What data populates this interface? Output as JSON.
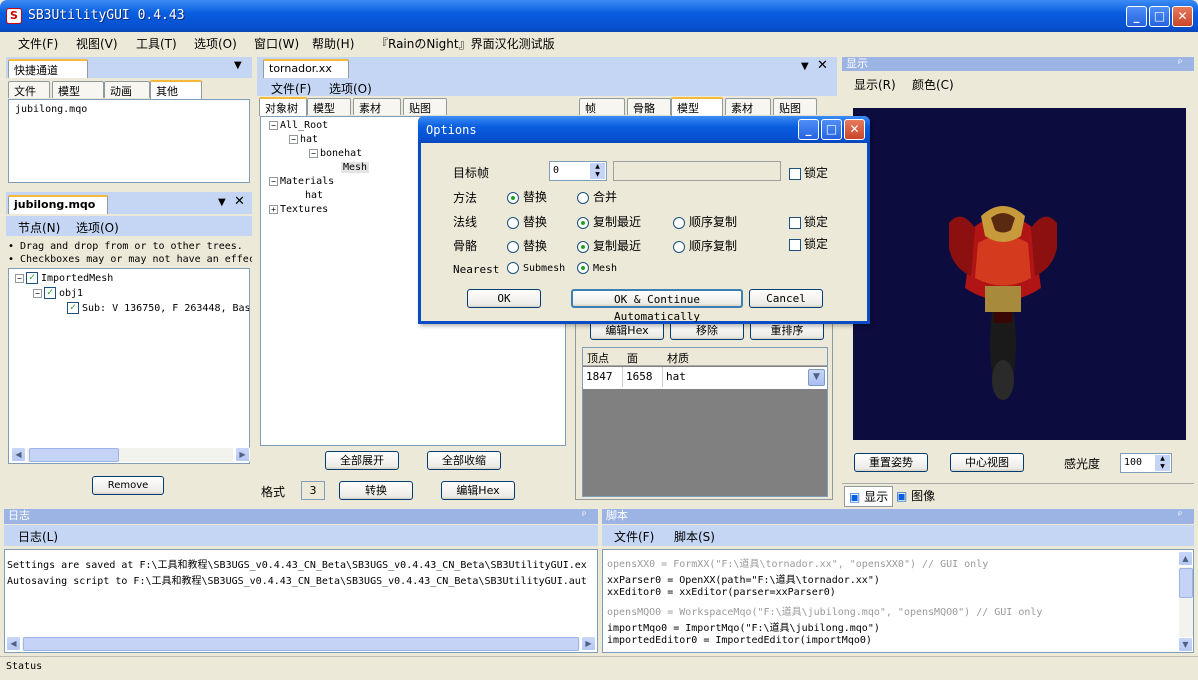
{
  "window": {
    "title": "SB3UtilityGUI 0.4.43"
  },
  "menubar": {
    "items": [
      "文件(F)",
      "视图(V)",
      "工具(T)",
      "选项(O)",
      "窗口(W)",
      "帮助(H)",
      "『RainのNight』界面汉化测试版"
    ]
  },
  "quick_access": {
    "tab": "快捷通道",
    "subtabs": [
      "文件",
      "模型",
      "动画",
      "其他"
    ],
    "active_subtab": "其他",
    "files": [
      "jubilong.mqo"
    ]
  },
  "mqo_panel": {
    "tab": "jubilong.mqo",
    "menu": [
      "节点(N)",
      "选项(O)"
    ],
    "hints": [
      "• Drag and drop from or to other trees.",
      "• Checkboxes may or may not have an effec"
    ],
    "tree": [
      "ImportedMesh",
      "obj1",
      "Sub: V 136750, F 263448, Bas"
    ],
    "remove_button": "Remove"
  },
  "xx_panel": {
    "tab": "tornador.xx",
    "menu": [
      "文件(F)",
      "选项(O)"
    ],
    "subtabs_left": [
      "对象树",
      "模型",
      "素材",
      "贴图"
    ],
    "active_left": "对象树",
    "tree": [
      "All_Root",
      "hat",
      "bonehat",
      "Mesh",
      "Materials",
      "hat",
      "Textures"
    ],
    "expand_all": "全部展开",
    "collapse_all": "全部收缩",
    "format_label": "格式",
    "format_value": "3",
    "convert_button": "转换",
    "edit_hex_button": "编辑Hex",
    "subtabs_right": [
      "帧",
      "骨骼",
      "模型",
      "素材",
      "贴图"
    ],
    "active_right": "模型",
    "mesh_edit_hex": "编辑Hex",
    "mesh_remove": "移除",
    "mesh_reorder": "重排序",
    "grid_headers": [
      "顶点",
      "面",
      "材质"
    ],
    "grid_row": {
      "vertices": "1847",
      "faces": "1658",
      "material": "hat"
    }
  },
  "options_dialog": {
    "title": "Options",
    "target_frame_label": "目标帧",
    "target_frame_value": "0",
    "lock_label": "锁定",
    "method_label": "方法",
    "method_options": [
      "替换",
      "合并"
    ],
    "normals_label": "法线",
    "bones_label": "骨骼",
    "copy_options": [
      "替换",
      "复制最近",
      "顺序复制"
    ],
    "nearest_label": "Nearest",
    "nearest_options": [
      "Submesh",
      "Mesh"
    ],
    "ok": "OK",
    "ok_continue": "OK & Continue Automatically",
    "cancel": "Cancel"
  },
  "display_panel": {
    "title": "显示",
    "menu": [
      "显示(R)",
      "颜色(C)"
    ],
    "reset_pose": "重置姿势",
    "center_view": "中心视图",
    "sensitivity_label": "感光度",
    "sensitivity_value": "100",
    "bottom_tabs": [
      "显示",
      "图像"
    ],
    "viewport_bg": "#0d0c3f"
  },
  "log_panel": {
    "title": "日志",
    "menu": "日志(L)",
    "lines": [
      "Settings are saved at F:\\工具和教程\\SB3UGS_v0.4.43_CN_Beta\\SB3UGS_v0.4.43_CN_Beta\\SB3UtilityGUI.ex",
      "Autosaving script to F:\\工具和教程\\SB3UGS_v0.4.43_CN_Beta\\SB3UGS_v0.4.43_CN_Beta\\SB3UtilityGUI.aut"
    ]
  },
  "script_panel": {
    "title": "脚本",
    "menu": [
      "文件(F)",
      "脚本(S)"
    ],
    "lines": [
      "opensXX0 = FormXX(\"F:\\道具\\tornador.xx\", \"opensXX0\") // GUI only",
      "xxParser0 = OpenXX(path=\"F:\\道具\\tornador.xx\")",
      "xxEditor0 = xxEditor(parser=xxParser0)",
      "opensMQO0 = WorkspaceMqo(\"F:\\道具\\jubilong.mqo\", \"opensMQO0\") // GUI only",
      "importMqo0 = ImportMqo(\"F:\\道具\\jubilong.mqo\")",
      "importedEditor0 = ImportedEditor(importMqo0)"
    ],
    "dim_lines": [
      0,
      3
    ]
  },
  "statusbar": {
    "text": "Status"
  }
}
